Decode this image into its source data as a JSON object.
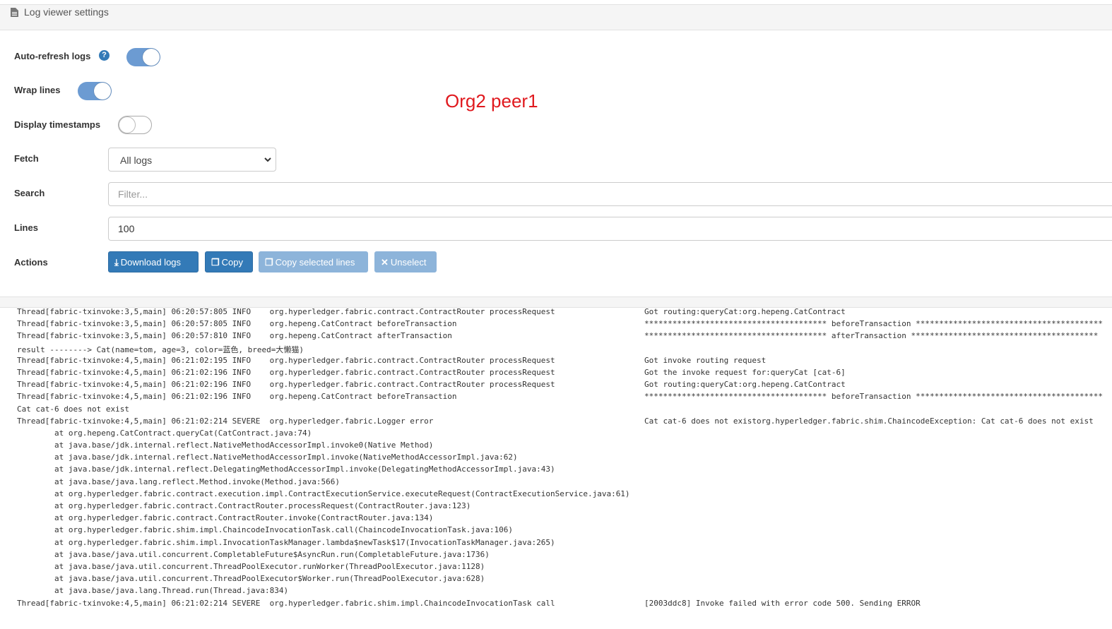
{
  "header": {
    "title": "Log viewer settings",
    "icon": "file-icon"
  },
  "settings": {
    "auto_refresh": {
      "label": "Auto-refresh logs",
      "help": "?",
      "enabled": true
    },
    "wrap_lines": {
      "label": "Wrap lines",
      "enabled": true
    },
    "display_timestamps": {
      "label": "Display timestamps",
      "enabled": false
    },
    "fetch": {
      "label": "Fetch",
      "value": "All logs"
    },
    "search": {
      "label": "Search",
      "placeholder": "Filter..."
    },
    "lines": {
      "label": "Lines",
      "value": "100"
    },
    "actions": {
      "label": "Actions"
    }
  },
  "annotation": "Org2 peer1",
  "buttons": {
    "download": "Download logs",
    "copy": "Copy",
    "copy_selected": "Copy selected lines",
    "unselect": "Unselect"
  },
  "colors": {
    "primary": "#337ab7",
    "toggle_on": "#6c9bd2",
    "annotation": "#e0191e"
  },
  "logs": [
    {
      "left": "Thread[fabric-txinvoke:3,5,main] 06:20:57:805 INFO    org.hyperledger.fabric.contract.ContractRouter processRequest",
      "right": "Got routing:queryCat:org.hepeng.CatContract"
    },
    {
      "left": "Thread[fabric-txinvoke:3,5,main] 06:20:57:805 INFO    org.hepeng.CatContract beforeTransaction",
      "right": "*************************************** beforeTransaction ****************************************"
    },
    {
      "left": "Thread[fabric-txinvoke:3,5,main] 06:20:57:810 INFO    org.hepeng.CatContract afterTransaction",
      "right": "*************************************** afterTransaction ****************************************"
    },
    {
      "left": "result --------> Cat(name=tom, age=3, color=蓝色, breed=大懒猫)",
      "right": ""
    },
    {
      "left": "Thread[fabric-txinvoke:4,5,main] 06:21:02:195 INFO    org.hyperledger.fabric.contract.ContractRouter processRequest",
      "right": "Got invoke routing request"
    },
    {
      "left": "Thread[fabric-txinvoke:4,5,main] 06:21:02:196 INFO    org.hyperledger.fabric.contract.ContractRouter processRequest",
      "right": "Got the invoke request for:queryCat [cat-6]"
    },
    {
      "left": "Thread[fabric-txinvoke:4,5,main] 06:21:02:196 INFO    org.hyperledger.fabric.contract.ContractRouter processRequest",
      "right": "Got routing:queryCat:org.hepeng.CatContract"
    },
    {
      "left": "Thread[fabric-txinvoke:4,5,main] 06:21:02:196 INFO    org.hepeng.CatContract beforeTransaction",
      "right": "*************************************** beforeTransaction ****************************************"
    },
    {
      "left": "Cat cat-6 does not exist",
      "right": ""
    },
    {
      "left": "Thread[fabric-txinvoke:4,5,main] 06:21:02:214 SEVERE  org.hyperledger.fabric.Logger error",
      "right": "Cat cat-6 does not existorg.hyperledger.fabric.shim.ChaincodeException: Cat cat-6 does not exist"
    },
    {
      "left": "        at org.hepeng.CatContract.queryCat(CatContract.java:74)",
      "right": ""
    },
    {
      "left": "        at java.base/jdk.internal.reflect.NativeMethodAccessorImpl.invoke0(Native Method)",
      "right": ""
    },
    {
      "left": "        at java.base/jdk.internal.reflect.NativeMethodAccessorImpl.invoke(NativeMethodAccessorImpl.java:62)",
      "right": ""
    },
    {
      "left": "        at java.base/jdk.internal.reflect.DelegatingMethodAccessorImpl.invoke(DelegatingMethodAccessorImpl.java:43)",
      "right": ""
    },
    {
      "left": "        at java.base/java.lang.reflect.Method.invoke(Method.java:566)",
      "right": ""
    },
    {
      "left": "        at org.hyperledger.fabric.contract.execution.impl.ContractExecutionService.executeRequest(ContractExecutionService.java:61)",
      "right": ""
    },
    {
      "left": "        at org.hyperledger.fabric.contract.ContractRouter.processRequest(ContractRouter.java:123)",
      "right": ""
    },
    {
      "left": "        at org.hyperledger.fabric.contract.ContractRouter.invoke(ContractRouter.java:134)",
      "right": ""
    },
    {
      "left": "        at org.hyperledger.fabric.shim.impl.ChaincodeInvocationTask.call(ChaincodeInvocationTask.java:106)",
      "right": ""
    },
    {
      "left": "        at org.hyperledger.fabric.shim.impl.InvocationTaskManager.lambda$newTask$17(InvocationTaskManager.java:265)",
      "right": ""
    },
    {
      "left": "        at java.base/java.util.concurrent.CompletableFuture$AsyncRun.run(CompletableFuture.java:1736)",
      "right": ""
    },
    {
      "left": "        at java.base/java.util.concurrent.ThreadPoolExecutor.runWorker(ThreadPoolExecutor.java:1128)",
      "right": ""
    },
    {
      "left": "        at java.base/java.util.concurrent.ThreadPoolExecutor$Worker.run(ThreadPoolExecutor.java:628)",
      "right": ""
    },
    {
      "left": "        at java.base/java.lang.Thread.run(Thread.java:834)",
      "right": ""
    },
    {
      "left": "Thread[fabric-txinvoke:4,5,main] 06:21:02:214 SEVERE  org.hyperledger.fabric.shim.impl.ChaincodeInvocationTask call",
      "right": "[2003ddc8] Invoke failed with error code 500. Sending ERROR"
    }
  ]
}
